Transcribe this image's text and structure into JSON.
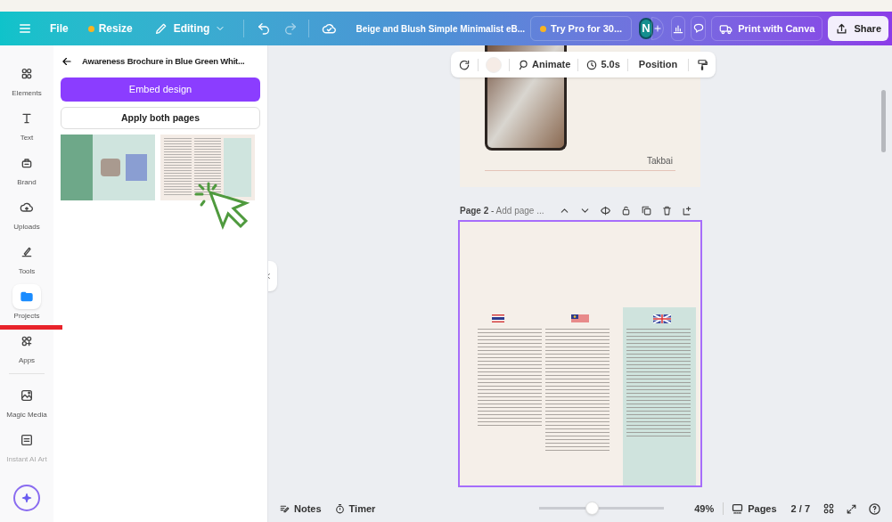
{
  "top_bar": {
    "menu_items": [
      {
        "kind": "menu"
      },
      {
        "kind": "text",
        "label": "File"
      },
      {
        "kind": "pro",
        "label": "Resize"
      },
      {
        "kind": "mode",
        "label": "Editing"
      }
    ],
    "document_title": "Beige and Blush Simple Minimalist eB...",
    "pro_button": "Try Pro for 30...",
    "avatar": "N",
    "print_button": "Print with Canva",
    "share_button": "Share"
  },
  "sidebar": {
    "items": [
      {
        "label": "Elements",
        "selected": false
      },
      {
        "label": "Text",
        "selected": false
      },
      {
        "label": "Brand",
        "selected": false
      },
      {
        "label": "Uploads",
        "selected": false
      },
      {
        "label": "Tools",
        "selected": false
      },
      {
        "label": "Projects",
        "selected": true
      },
      {
        "label": "Apps",
        "selected": false
      },
      {
        "label": "Magic Media",
        "selected": false
      },
      {
        "label": "Instant AI Art",
        "selected": false
      }
    ]
  },
  "panel": {
    "title": "Awareness Brochure in Blue Green Whit...",
    "embed_button": "Embed design",
    "apply_button": "Apply both pages"
  },
  "element_toolbar": {
    "animate": "Animate",
    "duration": "5.0s",
    "position": "Position"
  },
  "page_1": {
    "caption": "Takbai"
  },
  "page_2": {
    "label": "Page 2",
    "separator": "-",
    "title_placeholder": "Add page ..."
  },
  "bottom_bar": {
    "notes": "Notes",
    "timer": "Timer",
    "zoom": {
      "level": 0.42,
      "reading": "49%"
    },
    "pages": "Pages",
    "page_count": "2 / 7"
  }
}
